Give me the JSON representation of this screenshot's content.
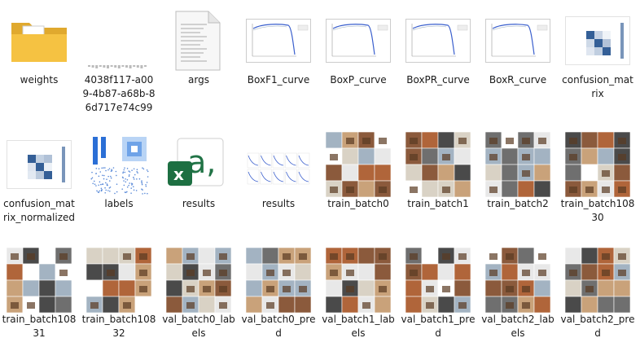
{
  "files": [
    {
      "label": "weights",
      "icon": "folder-icon"
    },
    {
      "label": "4038f117-a009-4b87-a68b-86d717e74c99",
      "icon": "image-file-icon"
    },
    {
      "label": "args",
      "icon": "text-document-icon"
    },
    {
      "label": "BoxF1_curve",
      "icon": "curve-plot-icon"
    },
    {
      "label": "BoxP_curve",
      "icon": "curve-plot-icon"
    },
    {
      "label": "BoxPR_curve",
      "icon": "curve-plot-icon"
    },
    {
      "label": "BoxR_curve",
      "icon": "curve-plot-icon"
    },
    {
      "label": "confusion_matrix",
      "icon": "confusion-matrix-icon"
    },
    {
      "label": "confusion_matrix_normalized",
      "icon": "confusion-matrix-icon"
    },
    {
      "label": "labels",
      "icon": "labels-plot-icon"
    },
    {
      "label": "results",
      "icon": "excel-icon"
    },
    {
      "label": "results",
      "icon": "results-plot-icon"
    },
    {
      "label": "train_batch0",
      "icon": "image-mosaic-icon"
    },
    {
      "label": "train_batch1",
      "icon": "image-mosaic-icon"
    },
    {
      "label": "train_batch2",
      "icon": "image-mosaic-icon"
    },
    {
      "label": "train_batch10830",
      "icon": "image-mosaic-icon"
    },
    {
      "label": "train_batch10831",
      "icon": "image-mosaic-icon"
    },
    {
      "label": "train_batch10832",
      "icon": "image-mosaic-icon"
    },
    {
      "label": "val_batch0_labels",
      "icon": "image-mosaic-icon"
    },
    {
      "label": "val_batch0_pred",
      "icon": "image-mosaic-icon"
    },
    {
      "label": "val_batch1_labels",
      "icon": "image-mosaic-icon"
    },
    {
      "label": "val_batch1_pred",
      "icon": "image-mosaic-icon"
    },
    {
      "label": "val_batch2_labels",
      "icon": "image-mosaic-icon"
    },
    {
      "label": "val_batch2_pred",
      "icon": "image-mosaic-icon"
    }
  ],
  "colors": {
    "folder": "#f5c242",
    "excel": "#1d6f42",
    "plot_line": "#3a5fcd",
    "matrix": "#1f4e8c"
  }
}
